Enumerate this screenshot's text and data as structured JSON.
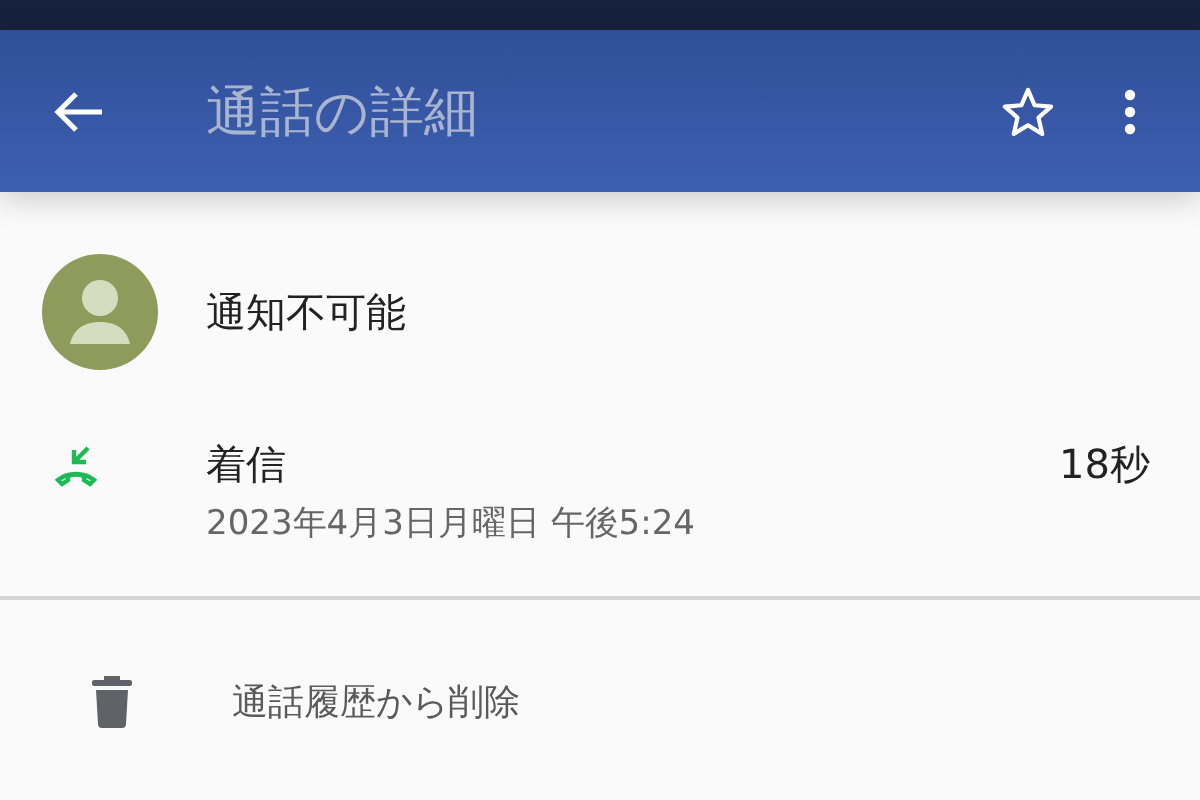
{
  "app_bar": {
    "title": "通話の詳細"
  },
  "contact": {
    "name": "通知不可能"
  },
  "call": {
    "kind": "incoming",
    "type_label": "着信",
    "date": "2023年4月3日月曜日 午後5:24",
    "duration": "18秒"
  },
  "actions": [
    {
      "label": "通話履歴から削除"
    }
  ]
}
